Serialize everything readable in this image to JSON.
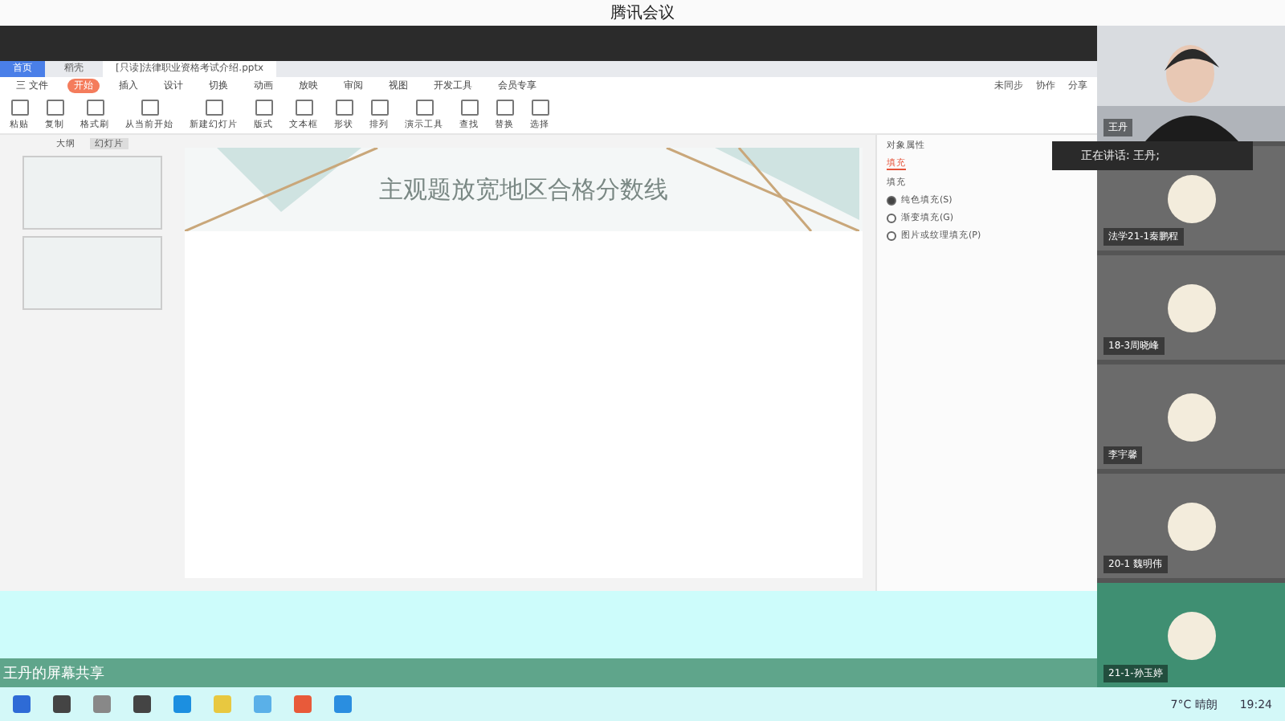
{
  "window": {
    "title": "腾讯会议"
  },
  "wps": {
    "tabs": [
      {
        "label": "首页",
        "selected": false,
        "kind": "home"
      },
      {
        "label": "稻壳",
        "selected": false,
        "kind": "doc"
      },
      {
        "label": "[只读]法律职业资格考试介绍.pptx",
        "selected": true,
        "kind": "doc"
      }
    ],
    "menu": [
      {
        "label": "三 文件",
        "selected": false
      },
      {
        "label": "开始",
        "selected": true
      },
      {
        "label": "插入",
        "selected": false
      },
      {
        "label": "设计",
        "selected": false
      },
      {
        "label": "切换",
        "selected": false
      },
      {
        "label": "动画",
        "selected": false
      },
      {
        "label": "放映",
        "selected": false
      },
      {
        "label": "审阅",
        "selected": false
      },
      {
        "label": "视图",
        "selected": false
      },
      {
        "label": "开发工具",
        "selected": false
      },
      {
        "label": "会员专享",
        "selected": false
      }
    ],
    "actions": [
      "未同步",
      "协作",
      "分享"
    ],
    "tools": [
      "粘贴",
      "复制",
      "格式刷",
      "从当前开始",
      "新建幻灯片",
      "版式",
      "文本框",
      "形状",
      "排列",
      "演示工具",
      "查找",
      "替换",
      "选择"
    ],
    "panel_tabs": [
      {
        "label": "大纲",
        "selected": false
      },
      {
        "label": "幻灯片",
        "selected": true
      }
    ],
    "slide_title": "主观题放宽地区合格分数线",
    "side_panel": {
      "title": "对象属性",
      "tab": "填充",
      "section": "填充",
      "options": [
        {
          "label": "纯色填充(S)",
          "selected": true
        },
        {
          "label": "渐变填充(G)",
          "selected": false
        },
        {
          "label": "图片或纹理填充(P)",
          "selected": false
        }
      ]
    }
  },
  "share_label": "王丹的屏幕共享",
  "speaking": "正在讲话: 王丹;",
  "participants": [
    {
      "name": "王丹",
      "kind": "video"
    },
    {
      "name": "法学21-1秦鹏程",
      "kind": "avatar"
    },
    {
      "name": "18-3周晓峰",
      "kind": "avatar"
    },
    {
      "name": "李宇馨",
      "kind": "avatar"
    },
    {
      "name": "20-1 魏明伟",
      "kind": "avatar"
    },
    {
      "name": "21-1-孙玉婷",
      "kind": "avatar"
    }
  ],
  "taskbar": {
    "weather": "7°C 晴朗",
    "time": "19:24"
  }
}
